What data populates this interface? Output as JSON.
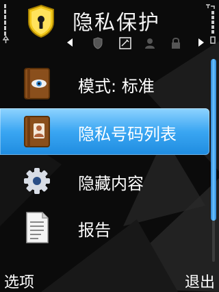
{
  "header": {
    "title": "隐私保护",
    "app_icon": "shield-keyhole-icon",
    "status_left_icon": "signal-strength-icon",
    "status_right_icon": "battery-level-icon",
    "tabs": [
      {
        "icon": "shield-icon",
        "active": false
      },
      {
        "icon": "notebook-icon",
        "active": true
      },
      {
        "icon": "person-icon",
        "active": false
      },
      {
        "icon": "lock-icon",
        "active": false
      }
    ]
  },
  "list": {
    "items": [
      {
        "label": "模式: 标准",
        "icon": "eye-book-icon",
        "selected": false
      },
      {
        "label": "隐私号码列表",
        "icon": "contact-book-icon",
        "selected": true
      },
      {
        "label": "隐藏内容",
        "icon": "gear-icon",
        "selected": false
      },
      {
        "label": "报告",
        "icon": "report-document-icon",
        "selected": false
      }
    ]
  },
  "softkeys": {
    "left": "选项",
    "right": "退出"
  },
  "colors": {
    "highlight": "#3aa6f2",
    "shield": "#f2c81b"
  }
}
